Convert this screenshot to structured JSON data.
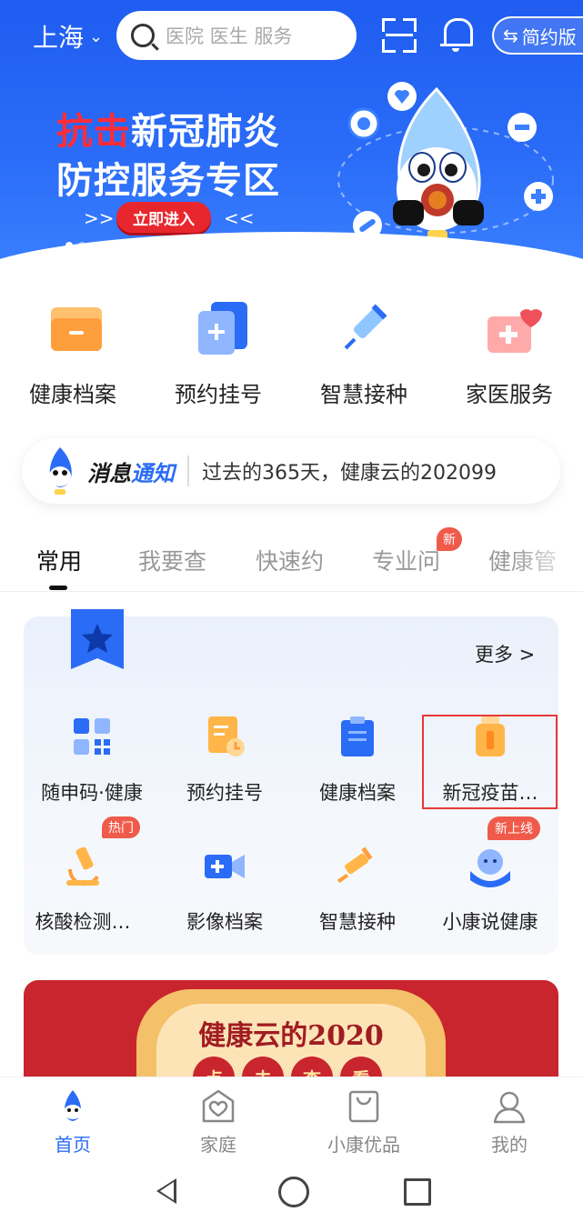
{
  "header": {
    "city": "上海",
    "search_placeholder": "医院 医生 服务",
    "simple_mode_label": "简约版"
  },
  "banner": {
    "title_line1_highlight": "抗击",
    "title_line1_rest": "新冠肺炎",
    "title_line2": "防控服务专区",
    "cta_label": "立即进入",
    "arrows_left": ">>",
    "arrows_right": "<<",
    "slide_count": 2,
    "active_slide": 1
  },
  "quick_entries": [
    {
      "label": "健康档案",
      "icon": "folder-icon"
    },
    {
      "label": "预约挂号",
      "icon": "add-document-icon"
    },
    {
      "label": "智慧接种",
      "icon": "syringe-icon"
    },
    {
      "label": "家医服务",
      "icon": "medical-kit-heart-icon"
    }
  ],
  "notice": {
    "tag_part1": "消息",
    "tag_part2": "通知",
    "message": "过去的365天，健康云的202099"
  },
  "tabs": [
    {
      "label": "常用",
      "active": true
    },
    {
      "label": "我要查"
    },
    {
      "label": "快速约"
    },
    {
      "label": "专业问",
      "badge": "新"
    },
    {
      "label": "健康管"
    }
  ],
  "favorites": {
    "more_label": "更多 >",
    "items": [
      {
        "label": "随申码·健康",
        "icon": "qr-code-icon"
      },
      {
        "label": "预约挂号",
        "icon": "calendar-clock-icon"
      },
      {
        "label": "健康档案",
        "icon": "clipboard-icon"
      },
      {
        "label": "新冠疫苗…",
        "icon": "vaccine-vial-icon",
        "highlighted": true
      },
      {
        "label": "核酸检测…",
        "icon": "microscope-icon",
        "badge": "热门"
      },
      {
        "label": "影像档案",
        "icon": "video-camera-icon"
      },
      {
        "label": "智慧接种",
        "icon": "syringe-icon"
      },
      {
        "label": "小康说健康",
        "icon": "mascot-hands-icon",
        "badge": "新上线"
      }
    ]
  },
  "promo": {
    "title": "健康云的2020",
    "chars": [
      "点",
      "击",
      "查",
      "看"
    ]
  },
  "bottom_nav": [
    {
      "label": "首页",
      "icon": "home-mascot-icon",
      "active": true
    },
    {
      "label": "家庭",
      "icon": "family-heart-icon"
    },
    {
      "label": "小康优品",
      "icon": "shopping-bag-icon"
    },
    {
      "label": "我的",
      "icon": "user-icon"
    }
  ],
  "colors": {
    "brand_blue": "#2b6cf6",
    "banner_red": "#ff2d3a",
    "badge_red": "#f05a4a",
    "highlight_red": "#e53935"
  }
}
